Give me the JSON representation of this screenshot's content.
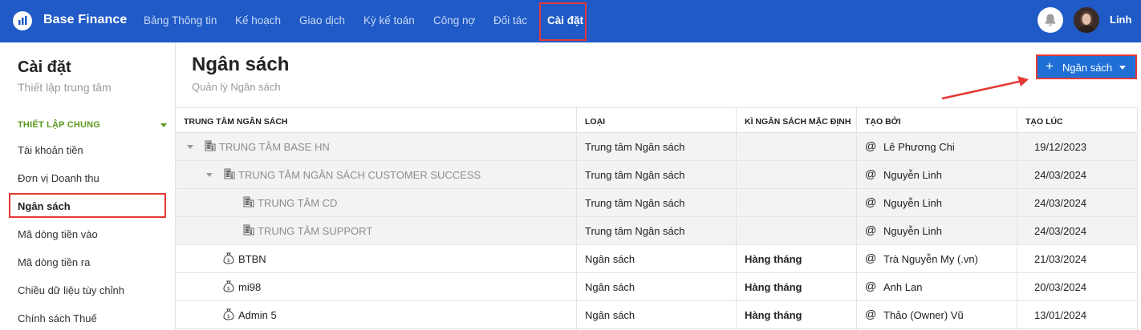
{
  "app": {
    "brand": "Base Finance",
    "user": "Linh"
  },
  "nav": [
    {
      "label": "Bảng Thông tin"
    },
    {
      "label": "Kế hoạch"
    },
    {
      "label": "Giao dịch"
    },
    {
      "label": "Kỳ kế toán"
    },
    {
      "label": "Công nợ"
    },
    {
      "label": "Đối tác"
    },
    {
      "label": "Cài đặt",
      "active": true
    }
  ],
  "sidebar": {
    "title": "Cài đặt",
    "subtitle": "Thiết lập trung tâm",
    "section": "THIẾT LẬP CHUNG",
    "items": [
      {
        "label": "Tài khoản tiền"
      },
      {
        "label": "Đơn vị Doanh thu"
      },
      {
        "label": "Ngân sách",
        "active": true
      },
      {
        "label": "Mã dòng tiền vào"
      },
      {
        "label": "Mã dòng tiền ra"
      },
      {
        "label": "Chiều dữ liệu tùy chỉnh"
      },
      {
        "label": "Chính sách Thuế"
      }
    ]
  },
  "page": {
    "title": "Ngân sách",
    "subtitle": "Quản lý Ngân sách",
    "add_button": "Ngân sách",
    "add_icon": "+"
  },
  "table": {
    "headers": [
      "TRUNG TÂM NGÂN SÁCH",
      "LOẠI",
      "KÌ NGÂN SÁCH MẶC ĐỊNH",
      "TẠO BỞI",
      "TẠO LÚC"
    ],
    "rows": [
      {
        "name": "TRUNG TÂM BASE HN",
        "type": "Trung tâm Ngân sách",
        "period": "",
        "by": "Lê Phương Chi",
        "at": "19/12/2023"
      },
      {
        "name": "TRUNG TÂM NGÂN SÁCH CUSTOMER SUCCESS",
        "type": "Trung tâm Ngân sách",
        "period": "",
        "by": "Nguyễn Linh",
        "at": "24/03/2024"
      },
      {
        "name": "TRUNG TÂM CD",
        "type": "Trung tâm Ngân sách",
        "period": "",
        "by": "Nguyễn Linh",
        "at": "24/03/2024"
      },
      {
        "name": "TRUNG TÂM SUPPORT",
        "type": "Trung tâm Ngân sách",
        "period": "",
        "by": "Nguyễn Linh",
        "at": "24/03/2024"
      },
      {
        "name": "BTBN",
        "type": "Ngân sách",
        "period": "Hàng tháng",
        "by": "Trà Nguyễn My (.vn)",
        "at": "21/03/2024"
      },
      {
        "name": "mi98",
        "type": "Ngân sách",
        "period": "Hàng tháng",
        "by": "Anh Lan",
        "at": "20/03/2024"
      },
      {
        "name": "Admin 5",
        "type": "Ngân sách",
        "period": "Hàng tháng",
        "by": "Thảo (Owner) Vũ",
        "at": "13/01/2024"
      }
    ],
    "at_symbol": "@"
  },
  "colors": {
    "topbar": "#1f5ac6",
    "accent_green": "#5a9a1e",
    "highlight": "#e53935",
    "button": "#1f6fd6"
  }
}
